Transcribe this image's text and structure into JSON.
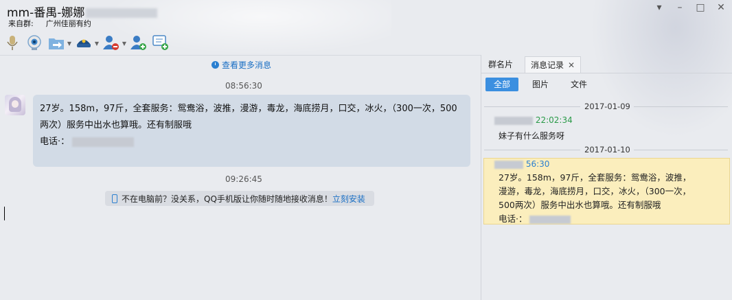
{
  "window": {
    "title": "mm-番禺-娜娜",
    "source_label": "来自群:",
    "source_group": "广州佳丽有约"
  },
  "toolbar": {
    "icons": [
      "microphone-icon",
      "video-icon",
      "file-transfer-icon",
      "police-icon",
      "remove-member-icon",
      "add-member-icon",
      "add-comment-icon"
    ]
  },
  "chat": {
    "more_link": "查看更多消息",
    "time1": "08:56:30",
    "message_lines": [
      "27岁。158m，97斤，全套服务：鸳鸯浴，波推，漫游，毒龙，海底捞月，口交，冰火，（300一次，500",
      "两次）服务中出水也算哦。还有制服哦"
    ],
    "phone_label": "电话·：",
    "time2": "09:26:45",
    "notice_text": "不在电脑前？没关系，QQ手机版让你随时随地接收消息！",
    "notice_link": "立刻安装"
  },
  "panel": {
    "tabs": [
      "群名片",
      "消息记录"
    ],
    "filters": [
      "全部",
      "图片",
      "文件"
    ],
    "history": [
      {
        "date": "2017-01-09",
        "time": "22:02:34",
        "text": "妹子有什么服务呀"
      },
      {
        "date": "2017-01-10",
        "time": "56:30",
        "lines": [
          "27岁。158m，97斤，全套服务：鸳鸯浴，波推，",
          "漫游，毒龙，海底捞月，口交，冰火，（300一次，",
          "500两次）服务中出水也算哦。还有制服哦"
        ],
        "phone_label": "电话·："
      }
    ]
  }
}
